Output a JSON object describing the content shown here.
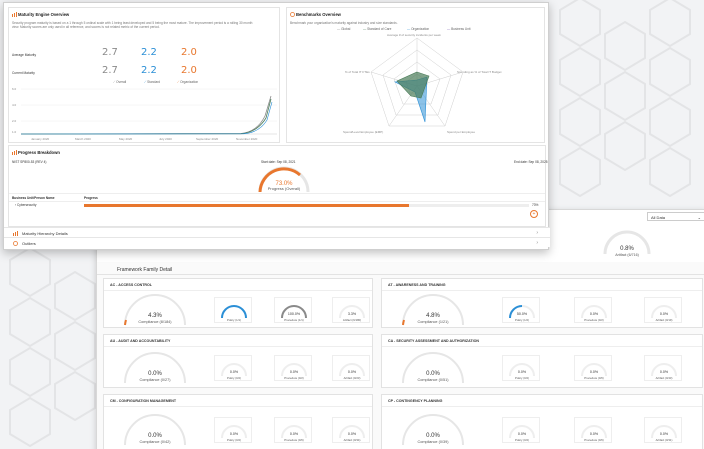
{
  "maturity": {
    "title": "Maturity Engine Overview",
    "description_1": "Security program maturity is based on a 1 through 5 ordinal scale with 1 being least developed and 5 being the most mature. The improvement period is a rolling 30 month",
    "description_2": "view. Maturity scores are only used in all reference, and scores is not related metric of the current period.",
    "average_label": "Average Maturity",
    "current_label": "Current Maturity",
    "avg_values": [
      "2.7",
      "2.2",
      "2.0"
    ],
    "cur_values": [
      "2.7",
      "2.2",
      "2.0"
    ],
    "legend": [
      "Overall",
      "Standard",
      "Organization"
    ],
    "y_ticks": [
      "6.0",
      "4.0",
      "2.0",
      "1.0"
    ],
    "x_ticks": [
      "January 2020",
      "March 2020",
      "May 2020",
      "July 2020",
      "September 2020",
      "November 2020"
    ]
  },
  "benchmarks": {
    "title": "Benchmarks Overview",
    "description": "Benchmark your organization's maturity against industry and size standards.",
    "legend": [
      "Global",
      "Standard of Care",
      "Organization",
      "Business Unit"
    ],
    "axes": [
      "Average # of security incidents per week",
      "Spending as % of Total IT Budget",
      "Spend per Employee",
      "Spend/Level Employee (EMP)",
      "% of Total IT FTEs"
    ]
  },
  "progress": {
    "title": "Progress Breakdown",
    "standard": "NIST SP800-53 (REV 4)",
    "start": "Start date: Sep 08, 2021",
    "end": "End date: Sep 08, 2025",
    "percent": "73.0%",
    "percent_label": "Progress (Overall)",
    "table_col1": "Business Unit/Person Name",
    "table_col2": "Progress",
    "row_name": "Cybersecurity",
    "row_value": "73%"
  },
  "rows": {
    "hierarchy": "Maturity Hierarchy Details",
    "outliers": "Outliers"
  },
  "back": {
    "select": "All Data",
    "artifact_pct": "0.8%",
    "artifact_label": "Artifact (6/716)",
    "ffd": "Framework Family Detail",
    "cards": [
      {
        "title": "AC - ACCESS CONTROL",
        "pct": "4.3%",
        "label": "Compliance (8/184)",
        "m": [
          "Policy (1/1)",
          "Procedure (1/1)",
          "3.3%"
        ],
        "mv": [
          "",
          "100.0%",
          "Artifact (6/180)"
        ]
      },
      {
        "title": "AT - AWARENESS AND TRAINING",
        "pct": "4.8%",
        "label": "Compliance (1/21)",
        "m": [
          "Policy (1/2)",
          "Procedure (0/2)",
          "Artifact (0/19)"
        ],
        "mv": [
          "50.0%",
          "0.0%",
          "0.0%"
        ]
      },
      {
        "title": "AU - AUDIT AND ACCOUNTABILITY",
        "pct": "0.0%",
        "label": "Compliance (0/27)",
        "m": [
          "Policy (0/2)",
          "Procedure (0/2)",
          "Artifact (0/23)"
        ],
        "mv": [
          "0.0%",
          "0.0%",
          "0.0%"
        ]
      },
      {
        "title": "CA - SECURITY ASSESSMENT AND AUTHORIZATION",
        "pct": "0.0%",
        "label": "Compliance (0/51)",
        "m": [
          "Policy (0/2)",
          "Procedure (0/6)",
          "Artifact (0/43)"
        ],
        "mv": [
          "0.0%",
          "0.0%",
          "0.0%"
        ]
      },
      {
        "title": "CM - CONFIGURATION MANAGEMENT",
        "pct": "0.0%",
        "label": "Compliance (0/42)",
        "m": [
          "Policy (0/2)",
          "Procedure (0/6)",
          "Artifact (0/34)"
        ],
        "mv": [
          "0.0%",
          "0.0%",
          "0.0%"
        ]
      },
      {
        "title": "CP - CONTINGENCY PLANNING",
        "pct": "0.0%",
        "label": "Compliance (0/39)",
        "m": [
          "Policy (0/2)",
          "Procedure (0/6)",
          "Artifact (0/31)"
        ],
        "mv": [
          "0.0%",
          "0.0%",
          "0.0%"
        ]
      }
    ]
  },
  "colors": {
    "orange": "#e8772e",
    "blue": "#2b8fd6",
    "grey": "#8a8a8a",
    "green": "#4a7c59"
  }
}
